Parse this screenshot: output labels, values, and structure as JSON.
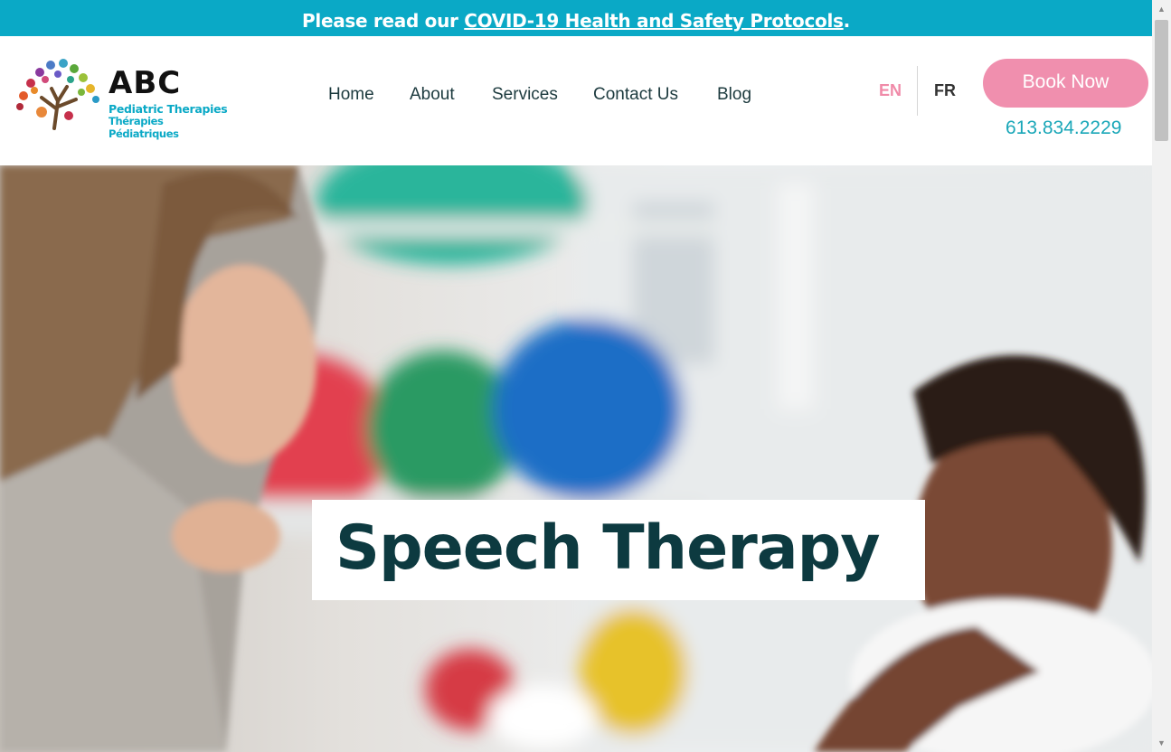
{
  "banner": {
    "prefix": "Please read our ",
    "link_text": "COVID-19 Health and Safety Protocols",
    "suffix": "."
  },
  "logo": {
    "title": "ABC",
    "line1": "Pediatric Therapies",
    "line2": "Thérapies Pédiatriques"
  },
  "nav": {
    "items": [
      {
        "label": "Home"
      },
      {
        "label": "About"
      },
      {
        "label": "Services"
      },
      {
        "label": "Contact Us"
      },
      {
        "label": "Blog"
      }
    ]
  },
  "language": {
    "en": "EN",
    "fr": "FR",
    "active": "EN"
  },
  "cta": {
    "book_label": "Book Now",
    "phone": "613.834.2229"
  },
  "hero": {
    "title": "Speech Therapy"
  },
  "colors": {
    "banner": "#0aa9c6",
    "accent_pink": "#f08fae",
    "phone": "#1aa7b8",
    "heading": "#0d3a40"
  }
}
